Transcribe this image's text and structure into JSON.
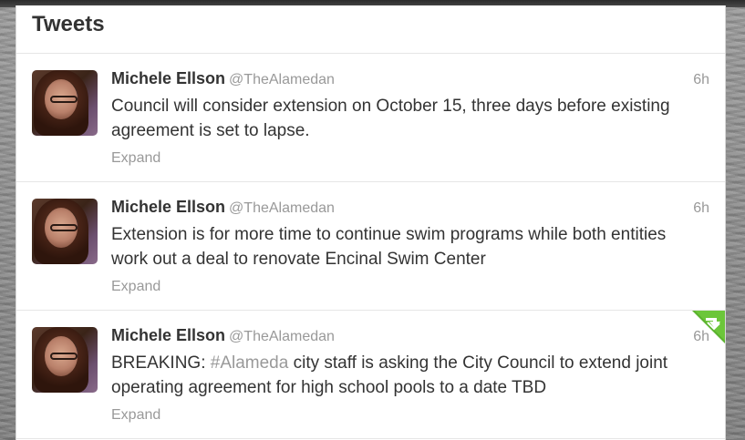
{
  "timeline": {
    "title": "Tweets",
    "tweets": [
      {
        "fullname": "Michele Ellson",
        "username": "@TheAlamedan",
        "time": "6h",
        "text": "Council will consider extension on October 15, three days before existing agreement is set to lapse.",
        "expand": "Expand"
      },
      {
        "fullname": "Michele Ellson",
        "username": "@TheAlamedan",
        "time": "6h",
        "text": "Extension is for more time to continue swim programs while both entities work out a deal to renovate Encinal Swim Center",
        "expand": "Expand"
      },
      {
        "fullname": "Michele Ellson",
        "username": "@TheAlamedan",
        "time": "6h",
        "text_before": "BREAKING: ",
        "hashtag": "#Alameda",
        "text_after": " city staff is asking the City Council to extend joint operating agreement for high school pools to a date TBD",
        "expand": "Expand",
        "badge": "retweet-ribbon-icon"
      }
    ]
  },
  "colors": {
    "name": "#333333",
    "meta": "#999999",
    "ribbon": "#5bb32e"
  }
}
